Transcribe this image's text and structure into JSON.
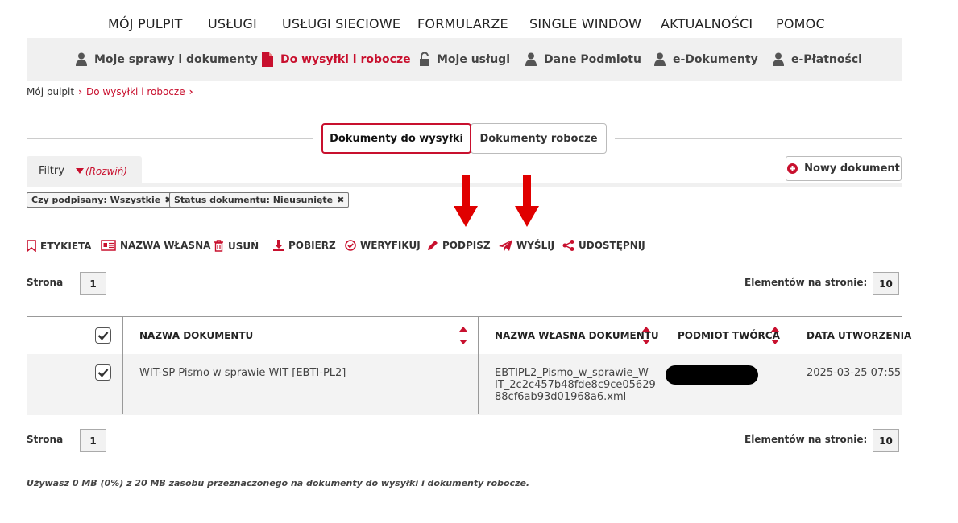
{
  "top_nav": [
    "MÓJ PULPIT",
    "USŁUGI",
    "USŁUGI SIECIOWE",
    "FORMULARZE",
    "SINGLE WINDOW",
    "AKTUALNOŚCI",
    "POMOC"
  ],
  "sub_nav": [
    {
      "label": "Moje sprawy i dokumenty",
      "icon": "user-icon"
    },
    {
      "label": "Do wysyłki i robocze",
      "icon": "document-icon",
      "active": true
    },
    {
      "label": "Moje usługi",
      "icon": "lock-icon"
    },
    {
      "label": "Dane Podmiotu",
      "icon": "user-icon"
    },
    {
      "label": "e-Dokumenty",
      "icon": "user-icon"
    },
    {
      "label": "e-Płatności",
      "icon": "user-icon"
    }
  ],
  "breadcrumb": [
    "Mój pulpit",
    "Do wysyłki i robocze"
  ],
  "tabs": [
    "Dokumenty do wysyłki",
    "Dokumenty robocze"
  ],
  "filters": {
    "label": "Filtry",
    "expand": "(Rozwiń)",
    "chips": [
      "Czy podpisany: Wszystkie",
      "Status dokumentu: Nieusunięte"
    ]
  },
  "new_document": "Nowy dokument",
  "toolbar": [
    {
      "label": "ETYKIETA",
      "icon": "bookmark-icon"
    },
    {
      "label": "NAZWA WŁASNA",
      "icon": "id-card-icon"
    },
    {
      "label": "USUŃ",
      "icon": "trash-icon"
    },
    {
      "label": "POBIERZ",
      "icon": "download-icon"
    },
    {
      "label": "WERYFIKUJ",
      "icon": "check-circle-icon"
    },
    {
      "label": "PODPISZ",
      "icon": "pencil-icon"
    },
    {
      "label": "WYŚLIJ",
      "icon": "paper-plane-icon"
    },
    {
      "label": "UDOSTĘPNIJ",
      "icon": "share-icon"
    }
  ],
  "paging": {
    "page_label": "Strona",
    "page": "1",
    "per_page_label": "Elementów na stronie:",
    "per_page": "10"
  },
  "table": {
    "columns": [
      "NAZWA DOKUMENTU",
      "NAZWA WŁASNA DOKUMENTU",
      "PODMIOT TWÓRCA",
      "DATA UTWORZENIA"
    ],
    "rows": [
      {
        "name": "WIT-SP Pismo w sprawie WIT [EBTI-PL2]",
        "own_name_lines": [
          "EBTIPL2_Pismo_w_sprawie_W",
          "IT_2c2c457b48fde8c9ce05629",
          "88cf6ab93d01968a6.xml"
        ],
        "creator": "",
        "created": "2025-03-25 07:55"
      }
    ]
  },
  "footnote": "Używasz 0 MB (0%) z 20 MB zasobu przeznaczonego na dokumenty do wysyłki i dokumenty robocze.",
  "colors": {
    "accent": "#c8102e",
    "nav_bg": "#f0f0f0"
  }
}
